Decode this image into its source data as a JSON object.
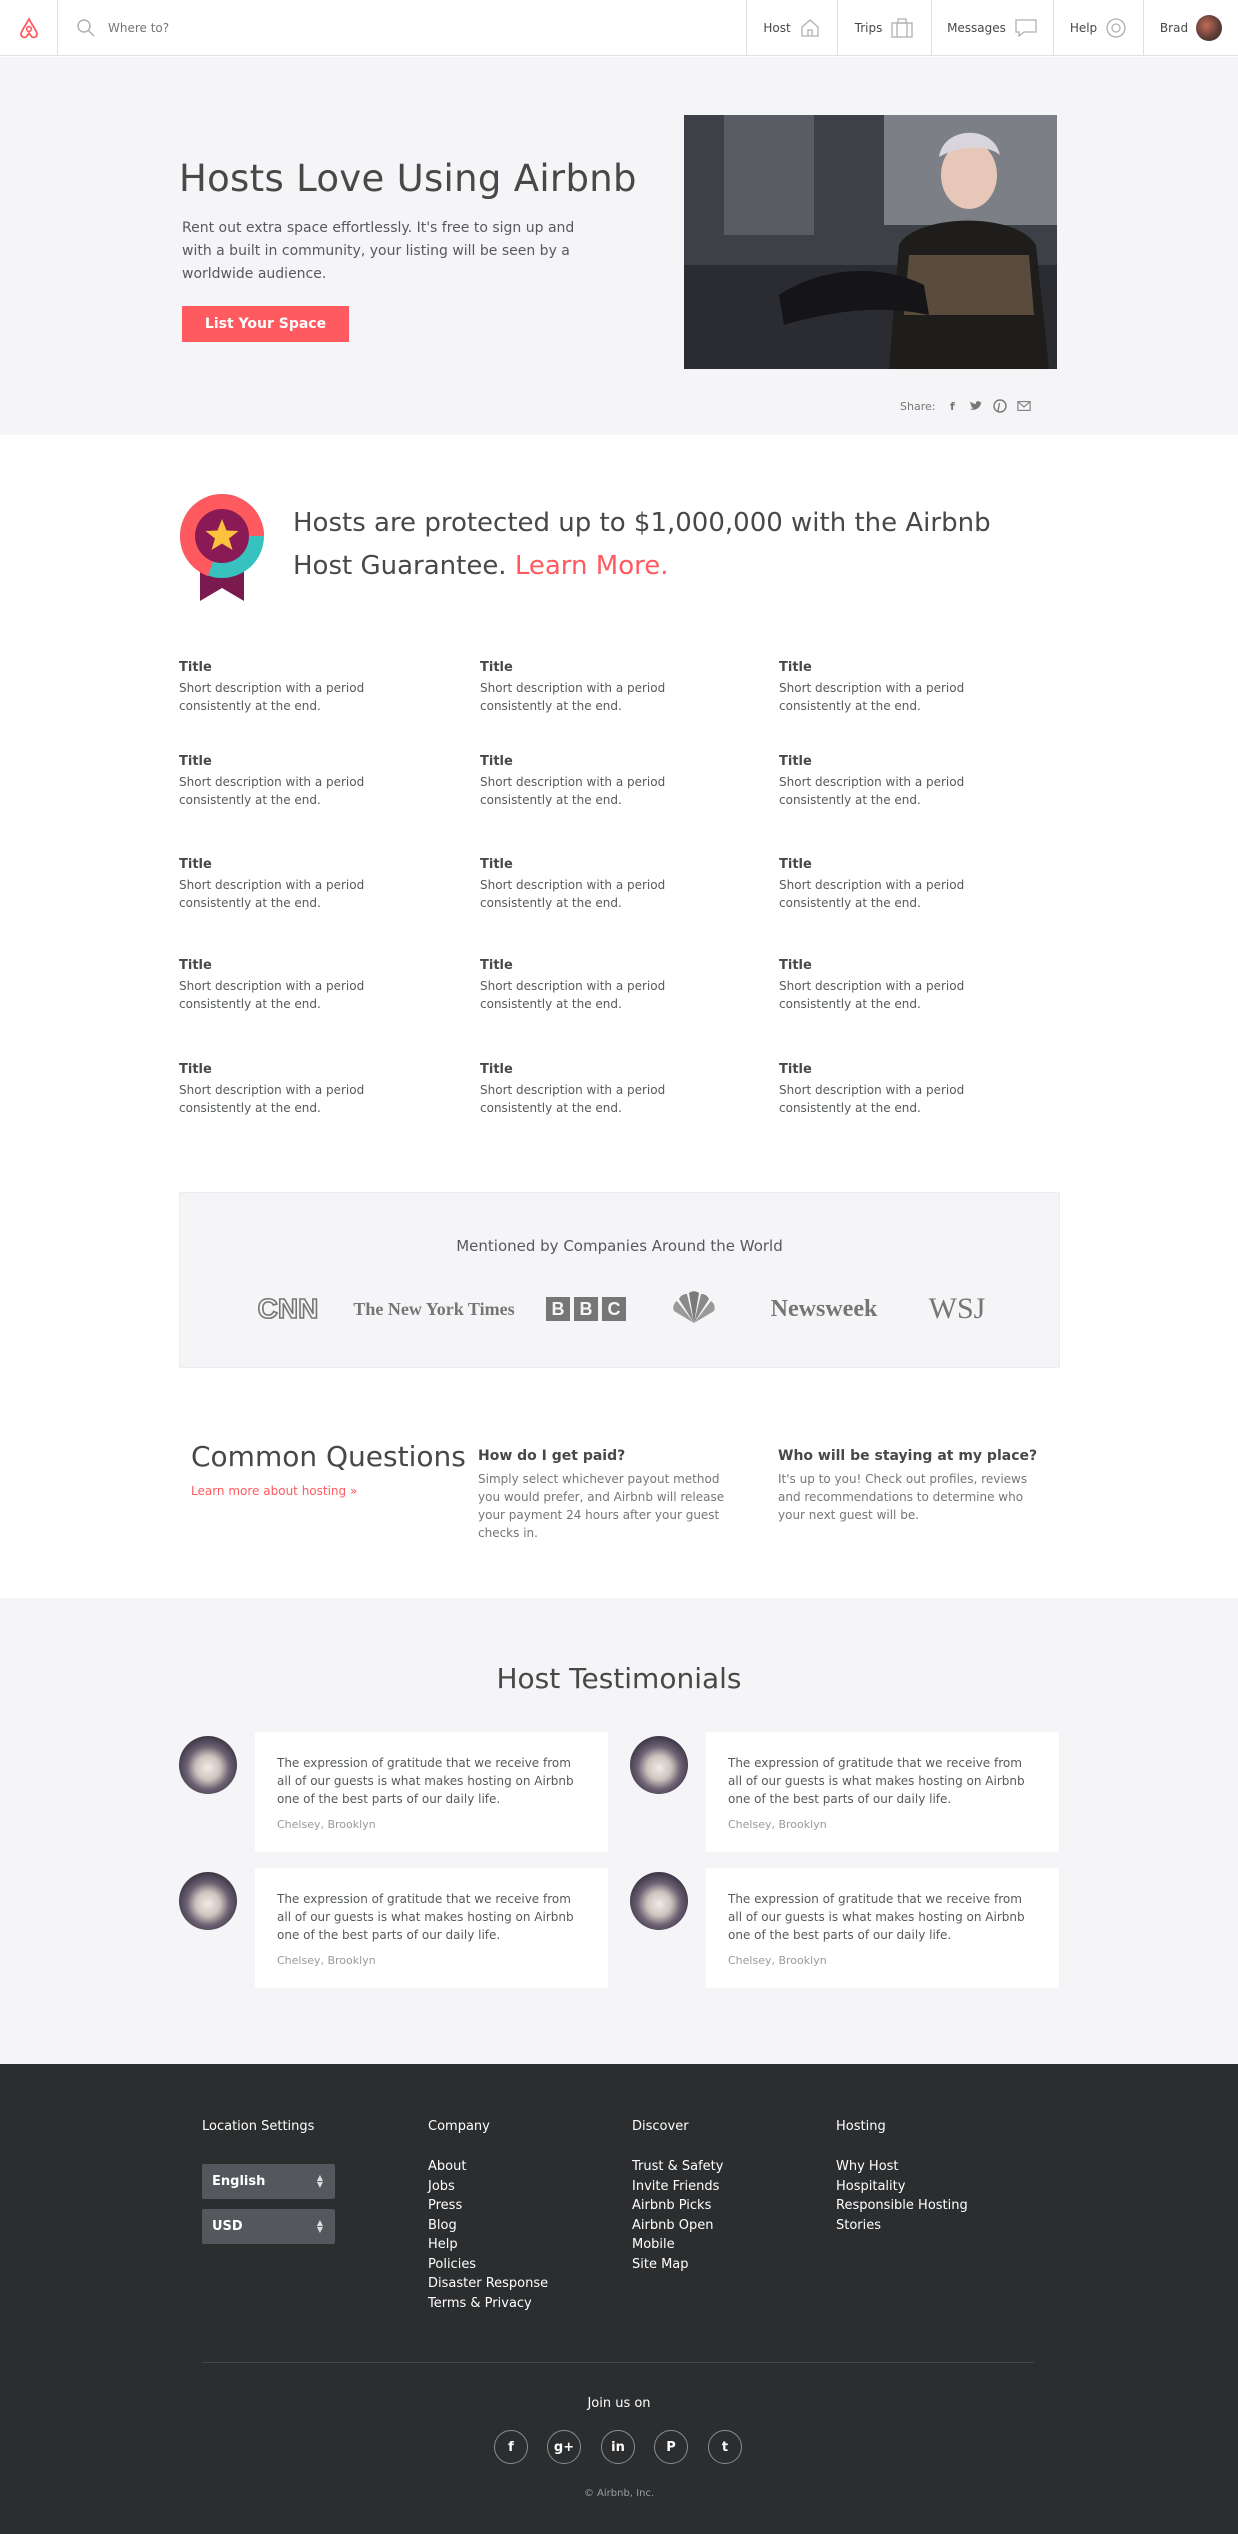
{
  "nav": {
    "search_placeholder": "Where to?",
    "items": [
      {
        "label": "Host",
        "icon": "house-icon"
      },
      {
        "label": "Trips",
        "icon": "suitcase-icon"
      },
      {
        "label": "Messages",
        "icon": "message-bubble-icon"
      },
      {
        "label": "Help",
        "icon": "help-lifebuoy-icon"
      },
      {
        "label": "Brad",
        "icon": "user-avatar"
      }
    ]
  },
  "hero": {
    "title": "Hosts Love Using Airbnb",
    "description": "Rent out extra space effortlessly. It's free to sign up and with a built in community, your listing will be seen by a worldwide audience.",
    "cta": "List Your Space",
    "share_label": "Share:"
  },
  "guarantee": {
    "text": "Hosts are protected up to $1,000,000 with the Airbnb Host Guarantee.",
    "link": "Learn More."
  },
  "features": [
    {
      "title": "Title",
      "desc": "Short description with a period consistently at the end."
    },
    {
      "title": "Title",
      "desc": "Short description with a period consistently at the end."
    },
    {
      "title": "Title",
      "desc": "Short description with a period consistently at the end."
    },
    {
      "title": "Title",
      "desc": "Short description with a period consistently at the end."
    },
    {
      "title": "Title",
      "desc": "Short description with a period consistently at the end."
    },
    {
      "title": "Title",
      "desc": "Short description with a period consistently at the end."
    },
    {
      "title": "Title",
      "desc": "Short description with a period consistently at the end."
    },
    {
      "title": "Title",
      "desc": "Short description with a period consistently at the end."
    },
    {
      "title": "Title",
      "desc": "Short description with a period consistently at the end."
    },
    {
      "title": "Title",
      "desc": "Short description with a period consistently at the end."
    },
    {
      "title": "Title",
      "desc": "Short description with a period consistently at the end."
    },
    {
      "title": "Title",
      "desc": "Short description with a period consistently at the end."
    },
    {
      "title": "Title",
      "desc": "Short description with a period consistently at the end."
    },
    {
      "title": "Title",
      "desc": "Short description with a period consistently at the end."
    },
    {
      "title": "Title",
      "desc": "Short description with a period consistently at the end."
    }
  ],
  "press": {
    "title": "Mentioned by Companies Around the World",
    "logos": [
      "CNN",
      "The New York Times",
      "BBC",
      "NBC",
      "Newsweek",
      "WSJ"
    ]
  },
  "questions": {
    "title": "Common Questions",
    "link": "Learn more about hosting »",
    "items": [
      {
        "q": "How do I get paid?",
        "a": "Simply select whichever payout method you would prefer, and Airbnb will release your payment 24 hours after your guest checks in."
      },
      {
        "q": "Who will be staying at my place?",
        "a": "It's up to you! Check out profiles, reviews and recommendations to determine who your next guest will be."
      }
    ]
  },
  "testimonials": {
    "title": "Host Testimonials",
    "items": [
      {
        "quote": "The expression of gratitude that we receive from all of our guests is what makes hosting on Airbnb one of the best parts of our daily life.",
        "author": "Chelsey, Brooklyn"
      },
      {
        "quote": "The expression of gratitude that we receive from all of our guests is what makes hosting on Airbnb one of the best parts of our daily life.",
        "author": "Chelsey, Brooklyn"
      },
      {
        "quote": "The expression of gratitude that we receive from all of our guests is what makes hosting on Airbnb one of the best parts of our daily life.",
        "author": "Chelsey, Brooklyn"
      },
      {
        "quote": "The expression of gratitude that we receive from all of our guests is what makes hosting on Airbnb one of the best parts of our daily life.",
        "author": "Chelsey, Brooklyn"
      }
    ]
  },
  "footer": {
    "location_title": "Location Settings",
    "language": "English",
    "currency": "USD",
    "company_title": "Company",
    "company": [
      "About",
      "Jobs",
      "Press",
      "Blog",
      "Help",
      "Policies",
      "Disaster Response",
      "Terms & Privacy"
    ],
    "discover_title": "Discover",
    "discover": [
      "Trust & Safety",
      "Invite Friends",
      "Airbnb Picks",
      "Airbnb Open",
      "Mobile",
      "Site Map"
    ],
    "hosting_title": "Hosting",
    "hosting": [
      "Why Host",
      "Hospitality",
      "Responsible Hosting",
      "Stories"
    ],
    "join": "Join us on",
    "social": [
      {
        "glyph": "f",
        "icon": "facebook-icon"
      },
      {
        "glyph": "g+",
        "icon": "google-plus-icon"
      },
      {
        "glyph": "in",
        "icon": "linkedin-icon"
      },
      {
        "glyph": "P",
        "icon": "pinterest-icon"
      },
      {
        "glyph": "t",
        "icon": "twitter-icon"
      }
    ],
    "copyright": "© Airbnb, Inc."
  },
  "colors": {
    "brand": "#ff5a5f",
    "hero_bg": "#f5f4f7",
    "footer_bg": "#2b2d2f"
  }
}
